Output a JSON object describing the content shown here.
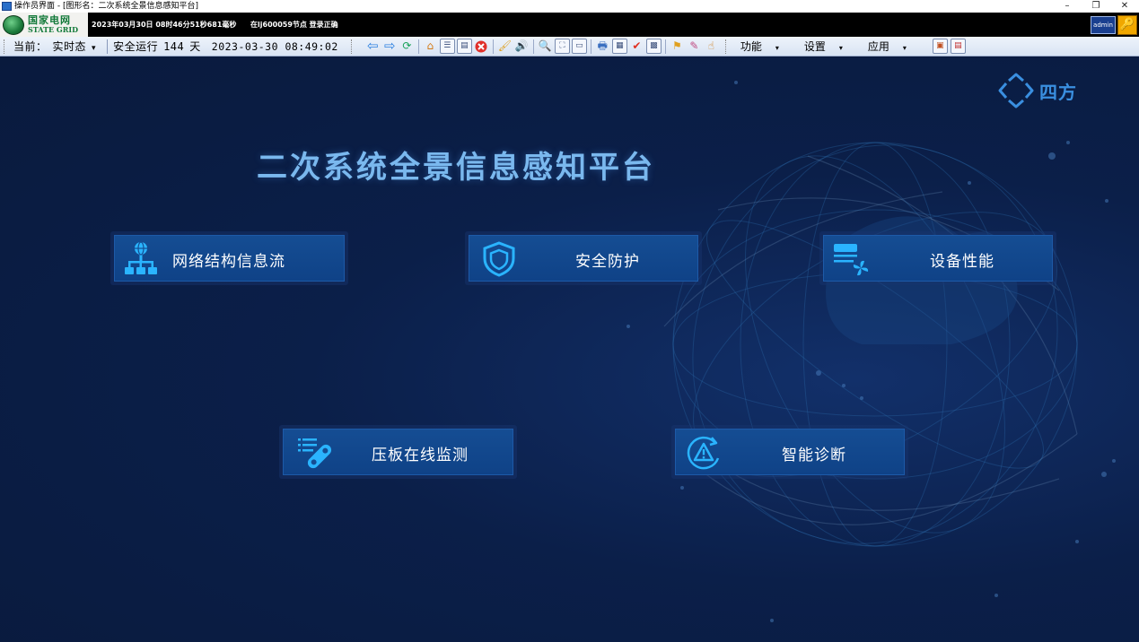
{
  "window": {
    "title": "操作员界面 - [图形名：二次系统全景信息感知平台]",
    "controls": [
      "–",
      "❐",
      "✕"
    ]
  },
  "infobar": {
    "logo_cn": "国家电网",
    "logo_en": "STATE GRID",
    "datetime_text": "2023年03月30日 08时46分51秒681毫秒",
    "node_text": "在lj600059节点 登录正确",
    "user": "admin",
    "key_icon": "🔑"
  },
  "toolbar": {
    "current_label": "当前：",
    "mode": "实时态",
    "mode_arrow": "▾",
    "safe_run_label": "安全运行",
    "safe_days": "144",
    "days_unit": "天",
    "datetime": "2023-03-30 08:49:02",
    "menus": [
      "功能",
      "设置",
      "应用"
    ],
    "icon_names": [
      "back-arrow-icon",
      "forward-arrow-icon",
      "refresh-icon",
      "home-icon",
      "list-icon",
      "panel-icon",
      "close-red-icon",
      "brush-icon",
      "speaker-icon",
      "zoom-out-icon",
      "fit-icon",
      "window-icon",
      "printer-icon",
      "report-icon",
      "check-icon",
      "table-icon",
      "flag-icon",
      "pen-icon",
      "hand-icon",
      "grid-icon",
      "doc-icon"
    ]
  },
  "brand": {
    "text": "四方"
  },
  "main": {
    "title": "二次系统全景信息感知平台",
    "cards": [
      {
        "label": "网络结构信息流",
        "icon": "network-tree-icon"
      },
      {
        "label": "安全防护",
        "icon": "shield-icon"
      },
      {
        "label": "设备性能",
        "icon": "device-fan-icon"
      },
      {
        "label": "压板在线监测",
        "icon": "platen-monitor-icon"
      },
      {
        "label": "智能诊断",
        "icon": "diagnosis-warning-icon"
      }
    ]
  },
  "colors": {
    "background": "#0a1a3c",
    "card_fill": "#154d93",
    "title_color": "#7ab8ee",
    "icon_cyan": "#2ab4ff"
  }
}
